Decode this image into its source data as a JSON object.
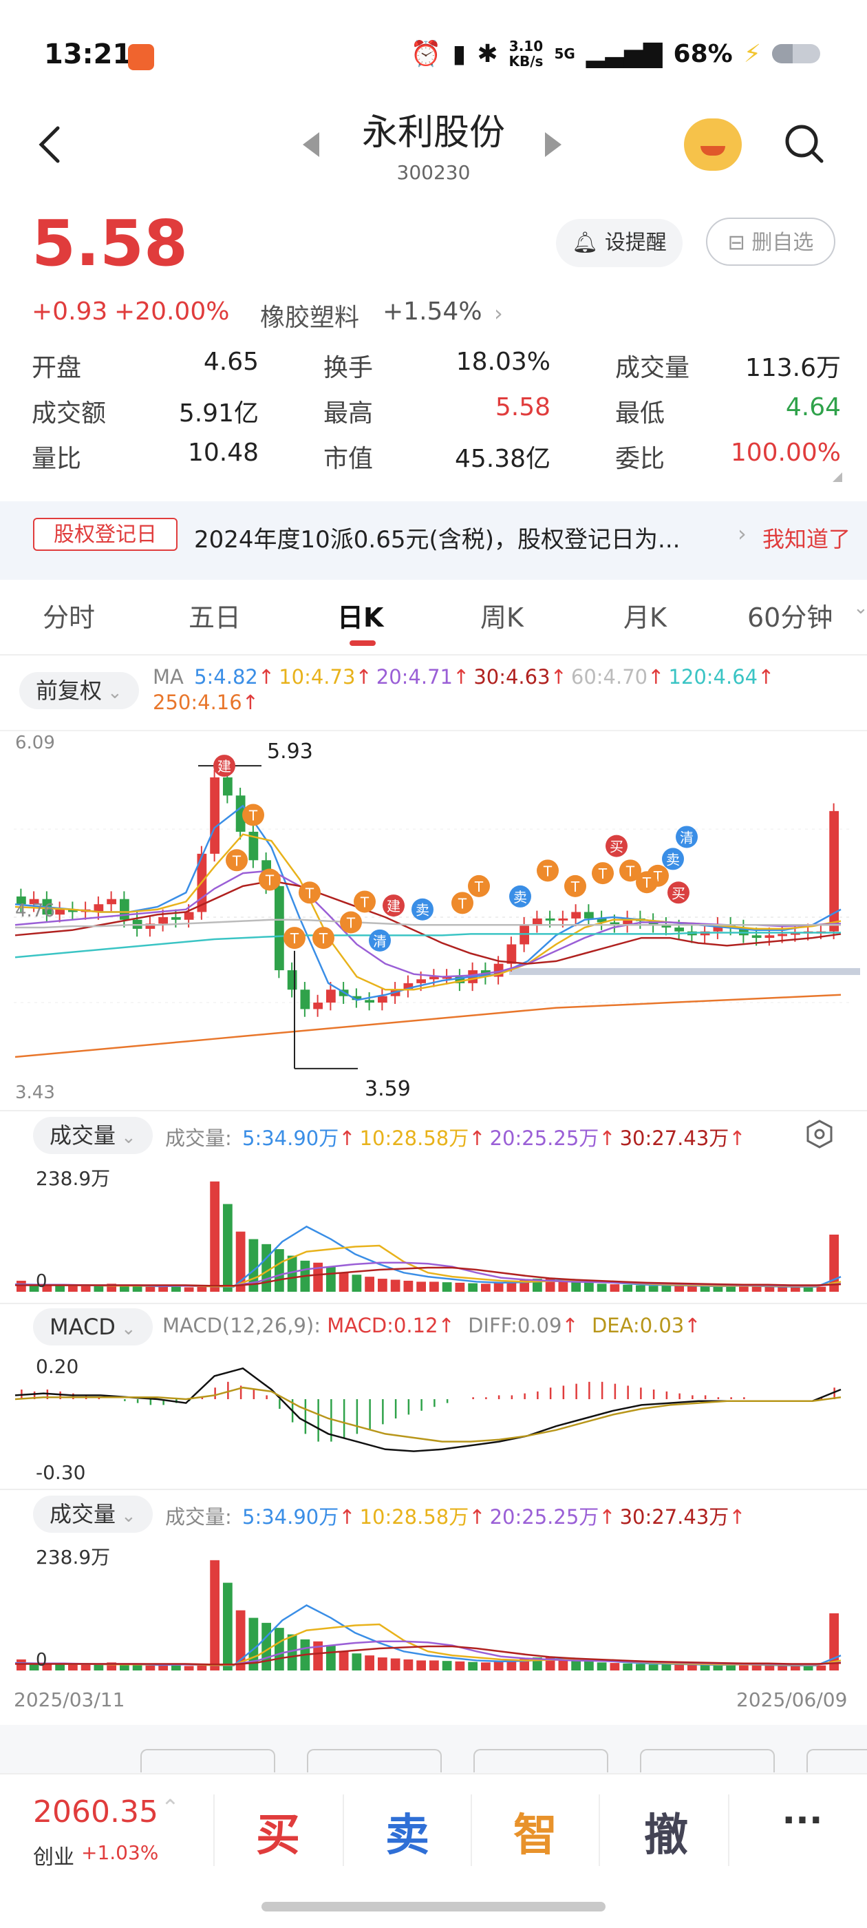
{
  "status_bar": {
    "time": "13:21",
    "net_speed_top": "3.10",
    "net_speed_bottom": "KB/s",
    "network": "5G",
    "battery": "68%",
    "icons": [
      "alarm-icon",
      "vibrate-icon",
      "bluetooth-icon",
      "signal-icon",
      "charging-icon",
      "battery-icon"
    ]
  },
  "header": {
    "name": "永利股份",
    "code": "300230"
  },
  "quote": {
    "price": "5.58",
    "change": "+0.93",
    "change_pct": "+20.00%",
    "sector_name": "橡胶塑料",
    "sector_change": "+1.54%",
    "alert_button": "设提醒",
    "remove_button": "删自选",
    "up_color": "#e03c3c",
    "down_color": "#2fa24a"
  },
  "stats": [
    {
      "label": "开盘",
      "value": "4.65",
      "color": "#222"
    },
    {
      "label": "换手",
      "value": "18.03%",
      "color": "#222"
    },
    {
      "label": "成交量",
      "value": "113.6万",
      "color": "#222"
    },
    {
      "label": "成交额",
      "value": "5.91亿",
      "color": "#222"
    },
    {
      "label": "最高",
      "value": "5.58",
      "color": "#e03c3c"
    },
    {
      "label": "最低",
      "value": "4.64",
      "color": "#2fa24a"
    },
    {
      "label": "量比",
      "value": "10.48",
      "color": "#222"
    },
    {
      "label": "市值",
      "value": "45.38亿",
      "color": "#222"
    },
    {
      "label": "委比",
      "value": "100.00%",
      "color": "#e03c3c"
    }
  ],
  "notice": {
    "tag": "股权登记日",
    "text": "2024年度10派0.65元(含税)，股权登记日为...",
    "action": "我知道了"
  },
  "tabs": [
    "分时",
    "五日",
    "日K",
    "周K",
    "月K",
    "60分钟"
  ],
  "active_tab": "日K",
  "kline": {
    "adjust_label": "前复权",
    "ma_title": "MA",
    "ma": [
      {
        "label": "5:4.82",
        "color": "#3a8ee6"
      },
      {
        "label": "10:4.73",
        "color": "#e8b21b"
      },
      {
        "label": "20:4.71",
        "color": "#9a5fd6"
      },
      {
        "label": "30:4.63",
        "color": "#b0211f"
      },
      {
        "label": "60:4.70",
        "color": "#bbbbbb"
      },
      {
        "label": "120:4.64",
        "color": "#3ac4c4"
      },
      {
        "label": "250:4.16",
        "color": "#e8762b"
      }
    ],
    "y_top": "6.09",
    "y_mid": "4.76",
    "y_bottom": "3.43",
    "high_label": "5.93",
    "low_label": "3.59",
    "markers": [
      "建",
      "T",
      "T",
      "T",
      "T",
      "T",
      "T",
      "T",
      "T",
      "清",
      "建",
      "卖",
      "T",
      "T",
      "卖",
      "T",
      "T",
      "T",
      "T",
      "T",
      "买",
      "T",
      "卖",
      "买",
      "清"
    ]
  },
  "volume": {
    "selector": "成交量",
    "title": "成交量:",
    "items": [
      {
        "label": "5:34.90万",
        "color": "#3a8ee6"
      },
      {
        "label": "10:28.58万",
        "color": "#e8b21b"
      },
      {
        "label": "20:25.25万",
        "color": "#9a5fd6"
      },
      {
        "label": "30:27.43万",
        "color": "#b0211f"
      }
    ],
    "y_top": "238.9万",
    "y_bottom": "0"
  },
  "macd": {
    "selector": "MACD",
    "params": "MACD(12,26,9):",
    "macd_label": "MACD:0.12",
    "diff_label": "DIFF:0.09",
    "dea_label": "DEA:0.03",
    "y_top": "0.20",
    "y_bottom": "-0.30"
  },
  "dates": {
    "start": "2025/03/11",
    "end": "2025/06/09"
  },
  "bottom": {
    "index_value": "2060.35",
    "index_name": "创业",
    "index_change": "+1.03%",
    "buy": "买",
    "sell": "卖",
    "smart": "智",
    "cancel": "撤",
    "more": "···"
  }
}
